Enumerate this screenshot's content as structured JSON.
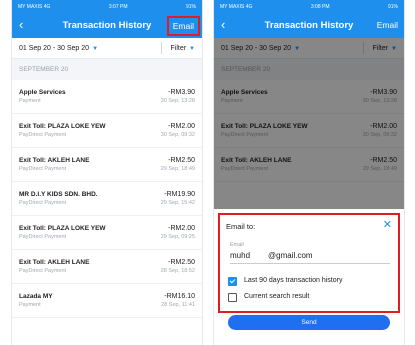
{
  "statusbar": {
    "carrier": "MY MAXIS 4G",
    "time_left": "3:07 PM",
    "time_right": "3:08 PM",
    "battery": "91%"
  },
  "header": {
    "back_icon": "chevron-left",
    "title": "Transaction History",
    "email_label": "Email"
  },
  "filter": {
    "date_range": "01 Sep 20 - 30 Sep 20",
    "filter_label": "Filter"
  },
  "section_label": "SEPTEMBER 20",
  "transactions": [
    {
      "title": "Apple Services",
      "subtitle": "Payment",
      "amount": "-RM3.90",
      "date": "30 Sep, 13:28"
    },
    {
      "title": "Exit Toll: PLAZA LOKE YEW",
      "subtitle": "PayDirect Payment",
      "amount": "-RM2.00",
      "date": "30 Sep, 09:32"
    },
    {
      "title": "Exit Toll: AKLEH LANE",
      "subtitle": "PayDirect Payment",
      "amount": "-RM2.50",
      "date": "29 Sep, 18:49"
    },
    {
      "title": "MR D.I.Y KIDS SDN. BHD.",
      "subtitle": "PayDirect Payment",
      "amount": "-RM19.90",
      "date": "29 Sep, 15:42"
    },
    {
      "title": "Exit Toll: PLAZA LOKE YEW",
      "subtitle": "PayDirect Payment",
      "amount": "-RM2.00",
      "date": "29 Sep, 09:25"
    },
    {
      "title": "Exit Toll: AKLEH LANE",
      "subtitle": "PayDirect Payment",
      "amount": "-RM2.50",
      "date": "28 Sep, 18:52"
    },
    {
      "title": "Lazada MY",
      "subtitle": "Payment",
      "amount": "-RM16.10",
      "date": "28 Sep, 11:41"
    }
  ],
  "email_sheet": {
    "title": "Email to:",
    "close_icon": "close-x",
    "field_label": "Email",
    "field_user": "muhd",
    "field_domain": "@gmail.com",
    "options": [
      {
        "label": "Last 90 days transaction history",
        "checked": true
      },
      {
        "label": "Current search result",
        "checked": false
      }
    ],
    "send_label": "Send"
  },
  "colors": {
    "brand_blue": "#1f8fee",
    "highlight_red": "#e01c24",
    "send_blue": "#1f6ff0"
  }
}
